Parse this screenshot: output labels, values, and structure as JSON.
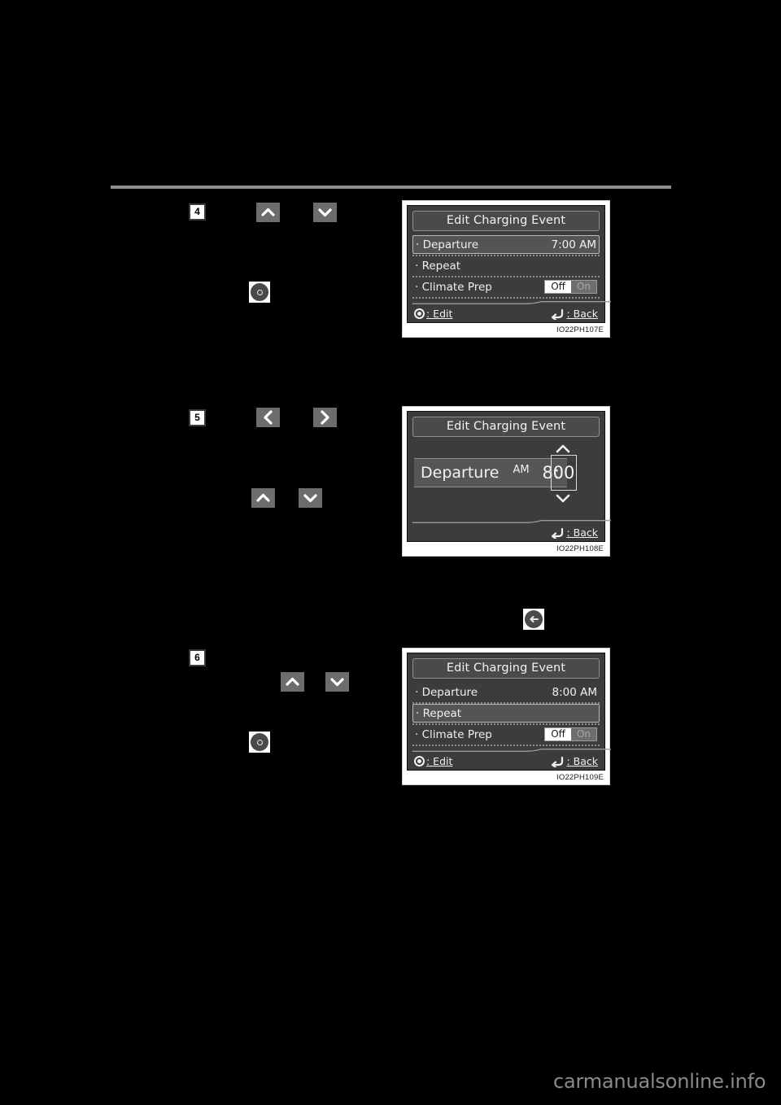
{
  "page": {
    "watermark": "carmanualsonline.info"
  },
  "steps": [
    {
      "number": "4"
    },
    {
      "number": "5"
    },
    {
      "number": "6"
    }
  ],
  "icons": {
    "chevron_up": "chevron-up-icon",
    "chevron_down": "chevron-down-icon",
    "chevron_left": "chevron-left-icon",
    "chevron_right": "chevron-right-icon",
    "knob_enter": "knob-enter-icon",
    "back_arrow": "back-arrow-icon"
  },
  "colors": {
    "page_background": "#000000",
    "rule": "#8e8e8e",
    "screen_background": "#3c3c3c",
    "screen_title_background": "#4a4a4a",
    "row_selected_background": "#545454",
    "toggle_selected_background": "#ffffff",
    "toggle_unselected_background": "#6e6e6e",
    "button_grey": "#6d6d6d",
    "watermark": "#8a8a8a"
  },
  "panels": [
    {
      "caption": "IO22PH107E",
      "title": "Edit Charging Event",
      "rows": [
        {
          "label": "· Departure",
          "value": "7:00 AM",
          "selected": true
        },
        {
          "label": "· Repeat",
          "value": "",
          "selected": false
        },
        {
          "label": "· Climate Prep",
          "toggle": {
            "selected": "Off",
            "options": [
              "Off",
              "On"
            ]
          },
          "selected": false
        }
      ],
      "hints": {
        "left": ": Edit",
        "right": ": Back"
      }
    },
    {
      "caption": "IO22PH108E",
      "title": "Edit Charging Event",
      "spinner": {
        "label": "Departure",
        "ampm": "AM",
        "hour": "8",
        "colon": ":",
        "minute": "00"
      },
      "hints": {
        "right": ": Back"
      }
    },
    {
      "caption": "IO22PH109E",
      "title": "Edit Charging Event",
      "rows": [
        {
          "label": "· Departure",
          "value": "8:00 AM",
          "selected": false
        },
        {
          "label": "· Repeat",
          "value": "",
          "selected": true
        },
        {
          "label": "· Climate Prep",
          "toggle": {
            "selected": "Off",
            "options": [
              "Off",
              "On"
            ]
          },
          "selected": false
        }
      ],
      "hints": {
        "left": ": Edit",
        "right": ": Back"
      }
    }
  ]
}
